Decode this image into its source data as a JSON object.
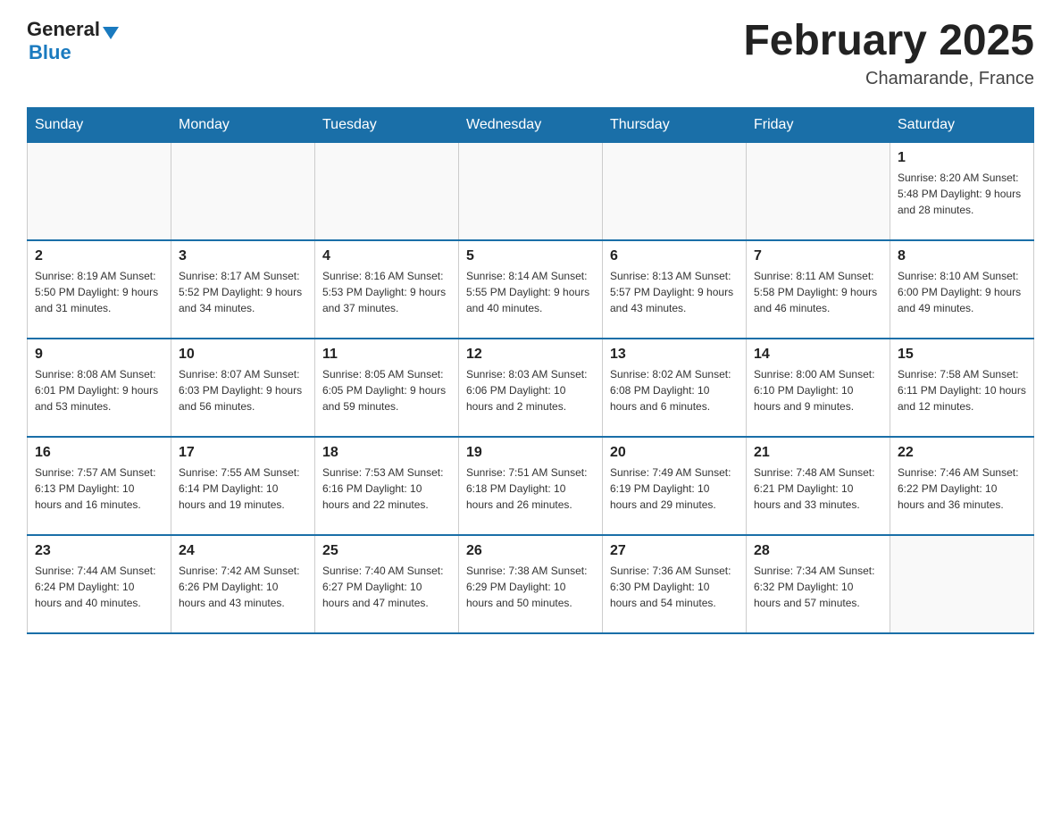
{
  "header": {
    "logo_general": "General",
    "logo_blue": "Blue",
    "month_title": "February 2025",
    "location": "Chamarande, France"
  },
  "weekdays": [
    "Sunday",
    "Monday",
    "Tuesday",
    "Wednesday",
    "Thursday",
    "Friday",
    "Saturday"
  ],
  "weeks": [
    [
      {
        "day": "",
        "info": ""
      },
      {
        "day": "",
        "info": ""
      },
      {
        "day": "",
        "info": ""
      },
      {
        "day": "",
        "info": ""
      },
      {
        "day": "",
        "info": ""
      },
      {
        "day": "",
        "info": ""
      },
      {
        "day": "1",
        "info": "Sunrise: 8:20 AM\nSunset: 5:48 PM\nDaylight: 9 hours and 28 minutes."
      }
    ],
    [
      {
        "day": "2",
        "info": "Sunrise: 8:19 AM\nSunset: 5:50 PM\nDaylight: 9 hours and 31 minutes."
      },
      {
        "day": "3",
        "info": "Sunrise: 8:17 AM\nSunset: 5:52 PM\nDaylight: 9 hours and 34 minutes."
      },
      {
        "day": "4",
        "info": "Sunrise: 8:16 AM\nSunset: 5:53 PM\nDaylight: 9 hours and 37 minutes."
      },
      {
        "day": "5",
        "info": "Sunrise: 8:14 AM\nSunset: 5:55 PM\nDaylight: 9 hours and 40 minutes."
      },
      {
        "day": "6",
        "info": "Sunrise: 8:13 AM\nSunset: 5:57 PM\nDaylight: 9 hours and 43 minutes."
      },
      {
        "day": "7",
        "info": "Sunrise: 8:11 AM\nSunset: 5:58 PM\nDaylight: 9 hours and 46 minutes."
      },
      {
        "day": "8",
        "info": "Sunrise: 8:10 AM\nSunset: 6:00 PM\nDaylight: 9 hours and 49 minutes."
      }
    ],
    [
      {
        "day": "9",
        "info": "Sunrise: 8:08 AM\nSunset: 6:01 PM\nDaylight: 9 hours and 53 minutes."
      },
      {
        "day": "10",
        "info": "Sunrise: 8:07 AM\nSunset: 6:03 PM\nDaylight: 9 hours and 56 minutes."
      },
      {
        "day": "11",
        "info": "Sunrise: 8:05 AM\nSunset: 6:05 PM\nDaylight: 9 hours and 59 minutes."
      },
      {
        "day": "12",
        "info": "Sunrise: 8:03 AM\nSunset: 6:06 PM\nDaylight: 10 hours and 2 minutes."
      },
      {
        "day": "13",
        "info": "Sunrise: 8:02 AM\nSunset: 6:08 PM\nDaylight: 10 hours and 6 minutes."
      },
      {
        "day": "14",
        "info": "Sunrise: 8:00 AM\nSunset: 6:10 PM\nDaylight: 10 hours and 9 minutes."
      },
      {
        "day": "15",
        "info": "Sunrise: 7:58 AM\nSunset: 6:11 PM\nDaylight: 10 hours and 12 minutes."
      }
    ],
    [
      {
        "day": "16",
        "info": "Sunrise: 7:57 AM\nSunset: 6:13 PM\nDaylight: 10 hours and 16 minutes."
      },
      {
        "day": "17",
        "info": "Sunrise: 7:55 AM\nSunset: 6:14 PM\nDaylight: 10 hours and 19 minutes."
      },
      {
        "day": "18",
        "info": "Sunrise: 7:53 AM\nSunset: 6:16 PM\nDaylight: 10 hours and 22 minutes."
      },
      {
        "day": "19",
        "info": "Sunrise: 7:51 AM\nSunset: 6:18 PM\nDaylight: 10 hours and 26 minutes."
      },
      {
        "day": "20",
        "info": "Sunrise: 7:49 AM\nSunset: 6:19 PM\nDaylight: 10 hours and 29 minutes."
      },
      {
        "day": "21",
        "info": "Sunrise: 7:48 AM\nSunset: 6:21 PM\nDaylight: 10 hours and 33 minutes."
      },
      {
        "day": "22",
        "info": "Sunrise: 7:46 AM\nSunset: 6:22 PM\nDaylight: 10 hours and 36 minutes."
      }
    ],
    [
      {
        "day": "23",
        "info": "Sunrise: 7:44 AM\nSunset: 6:24 PM\nDaylight: 10 hours and 40 minutes."
      },
      {
        "day": "24",
        "info": "Sunrise: 7:42 AM\nSunset: 6:26 PM\nDaylight: 10 hours and 43 minutes."
      },
      {
        "day": "25",
        "info": "Sunrise: 7:40 AM\nSunset: 6:27 PM\nDaylight: 10 hours and 47 minutes."
      },
      {
        "day": "26",
        "info": "Sunrise: 7:38 AM\nSunset: 6:29 PM\nDaylight: 10 hours and 50 minutes."
      },
      {
        "day": "27",
        "info": "Sunrise: 7:36 AM\nSunset: 6:30 PM\nDaylight: 10 hours and 54 minutes."
      },
      {
        "day": "28",
        "info": "Sunrise: 7:34 AM\nSunset: 6:32 PM\nDaylight: 10 hours and 57 minutes."
      },
      {
        "day": "",
        "info": ""
      }
    ]
  ]
}
